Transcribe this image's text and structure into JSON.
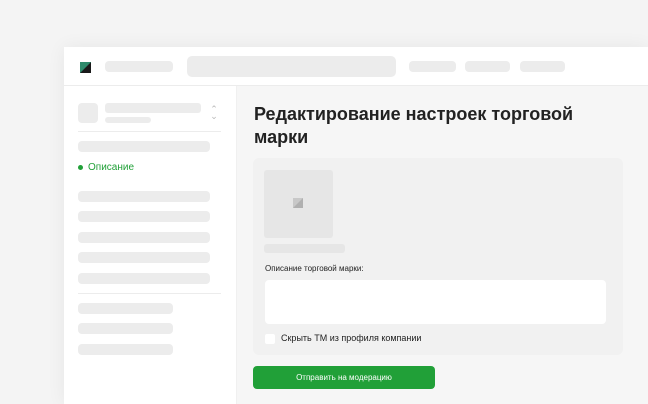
{
  "sidebar": {
    "active_item": {
      "label": "Описание"
    }
  },
  "main": {
    "title": "Редактирование настроек торговой марки",
    "description_label": "Описание торговой марки:",
    "description_value": "",
    "hide_checkbox_label": "Скрыть ТМ из профиля компании",
    "submit_label": "Отправить на модерацию"
  },
  "colors": {
    "accent": "#21a038",
    "skeleton": "#ececec",
    "background": "#f4f4f4"
  }
}
